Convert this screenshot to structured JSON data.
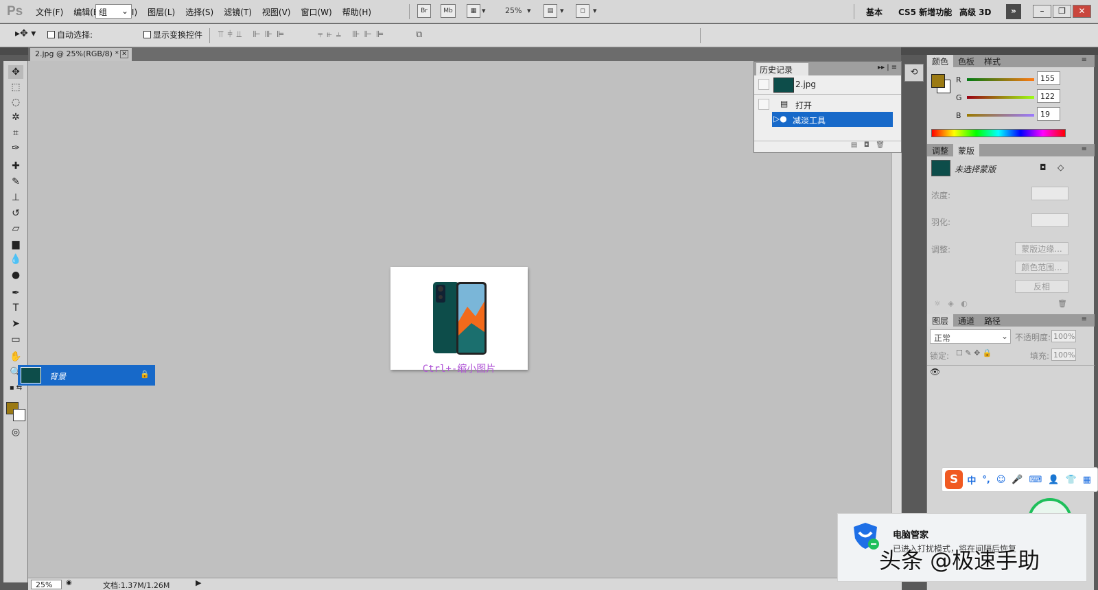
{
  "app": {
    "logo": "Ps",
    "menus": [
      "文件(F)",
      "编辑(E)",
      "图像(I)",
      "图层(L)",
      "选择(S)",
      "滤镜(T)",
      "视图(V)",
      "窗口(W)",
      "帮助(H)"
    ],
    "bridge_label": "Br",
    "minibridge_label": "Mb",
    "zoom": "25%",
    "workspaces": [
      "基本",
      "CS5 新增功能",
      "高级 3D"
    ],
    "window_buttons": [
      "–",
      "❐",
      "✕"
    ]
  },
  "options": {
    "auto_select_label": "自动选择:",
    "auto_select_value": "组",
    "show_transform_label": "显示变换控件"
  },
  "document": {
    "tab_title": "2.jpg @ 25%(RGB/8) *",
    "caption": "Ctrl+-缩小图片"
  },
  "status": {
    "zoom": "25%",
    "doc_info": "文档:1.37M/1.26M"
  },
  "history": {
    "tab": "历史记录",
    "snapshot": "2.jpg",
    "items": [
      "打开",
      "减淡工具"
    ]
  },
  "color_panel": {
    "tabs": [
      "颜色",
      "色板",
      "样式"
    ],
    "fg_color": "#9b7a13",
    "R": {
      "label": "R",
      "value": "155"
    },
    "G": {
      "label": "G",
      "value": "122"
    },
    "B": {
      "label": "B",
      "value": "19"
    }
  },
  "masks_panel": {
    "tabs": [
      "调整",
      "蒙版"
    ],
    "title": "未选择蒙版",
    "density_label": "浓度:",
    "feather_label": "羽化:",
    "refine_label": "调整:",
    "buttons": [
      "蒙版边缘...",
      "颜色范围...",
      "反相"
    ]
  },
  "layers_panel": {
    "tabs": [
      "图层",
      "通道",
      "路径"
    ],
    "blend_mode": "正常",
    "opacity_label": "不透明度:",
    "opacity": "100%",
    "lock_label": "锁定:",
    "fill_label": "填充:",
    "fill": "100%",
    "layer_name": "背景"
  },
  "ime": {
    "logo": "S",
    "mode": "中"
  },
  "notification": {
    "title": "电脑管家",
    "body": "已进入打扰模式，将在间隔后恢复"
  },
  "watermark": "头条 @极速手助"
}
